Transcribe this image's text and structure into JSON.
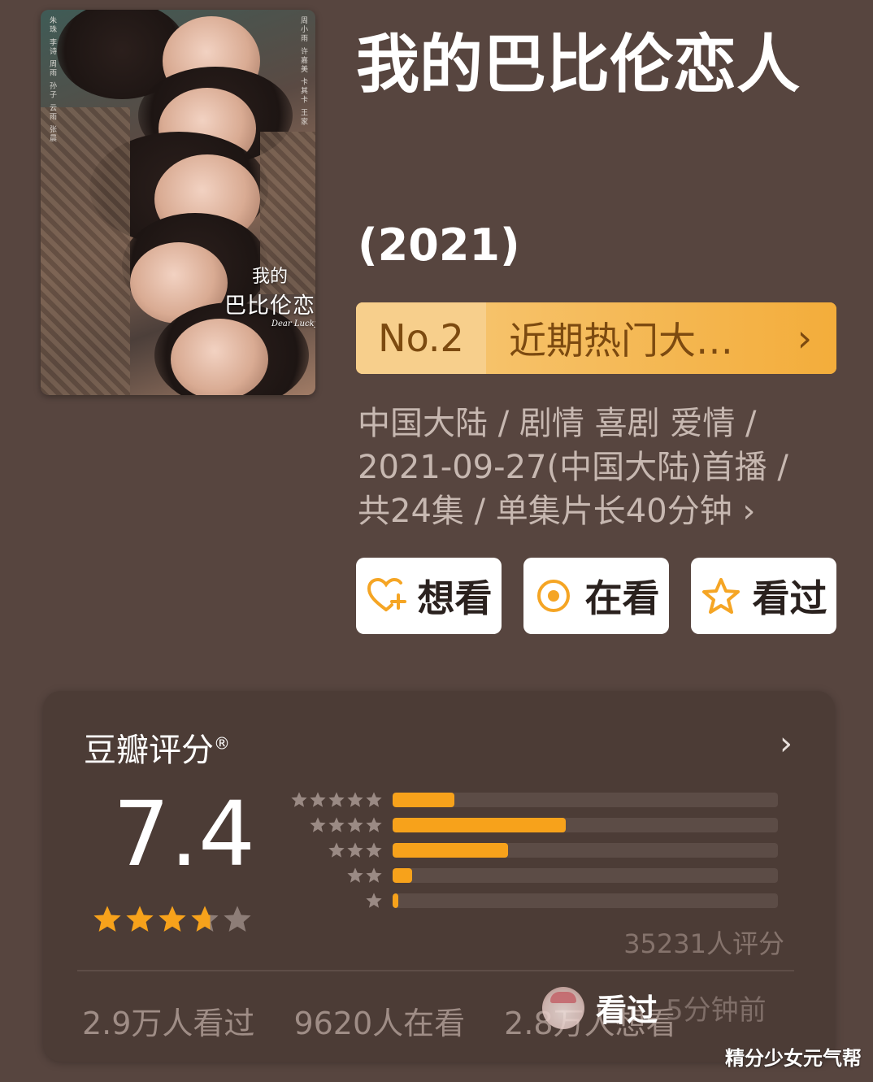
{
  "poster": {
    "logo_line1": "我的",
    "logo_line2": "巴比伦恋人",
    "logo_line3": "Dear Luckyz",
    "credits_left": "朱珠 李诗 周雨 孙子 云雨 张晨",
    "credits_right": "周小雨 许嘉美 卡其卡 王家"
  },
  "title": "我的巴比伦恋人",
  "year": "(2021)",
  "rank": {
    "number": "No.2",
    "label": "近期热门大…",
    "arrow": "›"
  },
  "meta": {
    "line1": "中国大陆 / 剧情 喜剧 爱情 /",
    "line2": "2021-09-27(中国大陆)首播 /",
    "line3": "共24集 / 单集片长40分钟 ›"
  },
  "actions": [
    {
      "label": "想看",
      "icon": "heart-plus-icon"
    },
    {
      "label": "在看",
      "icon": "watching-circle-icon"
    },
    {
      "label": "看过",
      "icon": "star-outline-icon"
    }
  ],
  "rating": {
    "title": "豆瓣评分",
    "registered": "®",
    "arrow": "›",
    "score": "7.4",
    "stars_value": 3.7,
    "distribution": [
      {
        "stars": 5,
        "fraction": 0.16
      },
      {
        "stars": 4,
        "fraction": 0.45
      },
      {
        "stars": 3,
        "fraction": 0.3
      },
      {
        "stars": 2,
        "fraction": 0.05
      },
      {
        "stars": 1,
        "fraction": 0.015
      }
    ],
    "count_text": "35231人评分"
  },
  "stats": {
    "watched": "2.9万人看过",
    "watching": "9620人在看",
    "want": "2.8万人想看"
  },
  "toast": {
    "text": "看过",
    "time": "5分钟前"
  },
  "watermark": "精分少女元气帮",
  "colors": {
    "background": "#57453f",
    "accent": "#f7a21b",
    "rank_bg": "#f3b449",
    "star_filled": "#f7a21b",
    "star_empty": "#8d7d77"
  }
}
